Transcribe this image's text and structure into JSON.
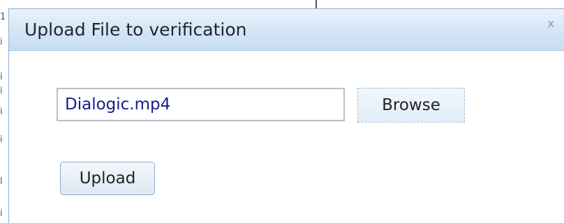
{
  "dialog": {
    "title": "Upload File to verification",
    "close_glyph": "x",
    "file_input": {
      "value": "Dialogic.mp4"
    },
    "browse_label": "Browse",
    "upload_label": "Upload"
  },
  "background": {
    "edge_marks": [
      "1",
      "i",
      "i",
      "i",
      "i",
      "i",
      "l",
      "i"
    ]
  },
  "colors": {
    "titlebar_gradient_top": "#eaf3fc",
    "titlebar_gradient_bottom": "#c7dcf2",
    "dialog_border": "#8fb1d6",
    "input_text": "#1a1a8c"
  }
}
